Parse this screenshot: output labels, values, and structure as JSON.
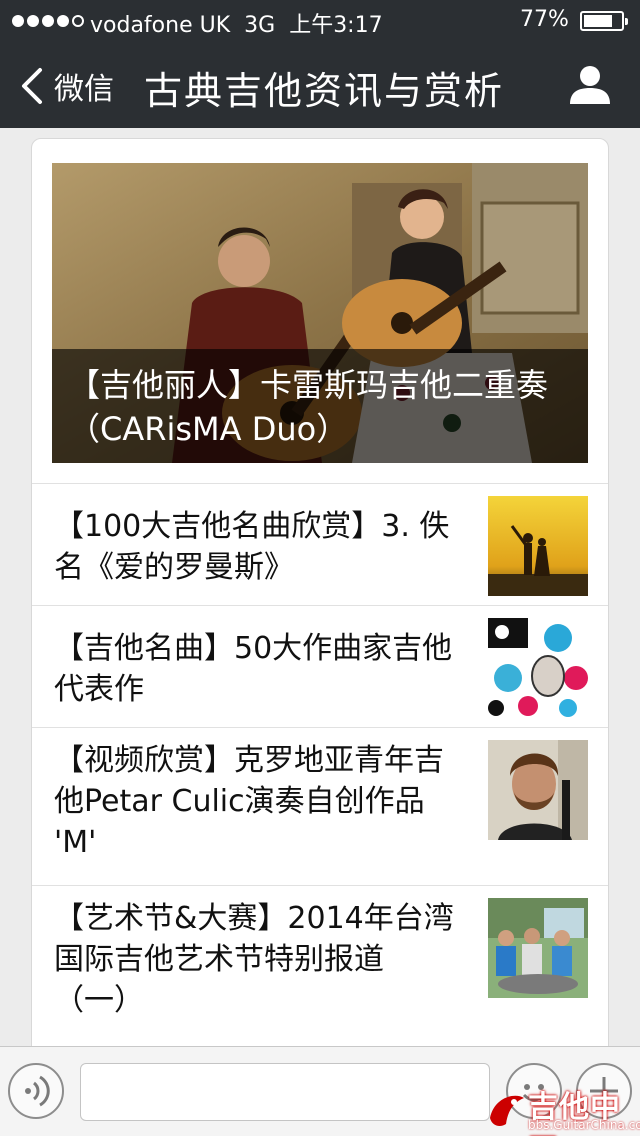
{
  "status_bar": {
    "carrier": "vodafone UK",
    "network": "3G",
    "time": "上午3:17",
    "battery_percent": "77%",
    "battery_level": 0.77,
    "signal_bars": 4
  },
  "nav": {
    "back_label": "微信",
    "title": "古典吉他资讯与赏析"
  },
  "hero": {
    "title": "【吉他丽人】卡雷斯玛吉他二重奏（CARisMA Duo）"
  },
  "articles": [
    {
      "title": "【100大吉他名曲欣赏】3. 佚名《爱的罗曼斯》",
      "thumb": "couple-sunset-thumbnail"
    },
    {
      "title": "【吉他名曲】50大作曲家吉他代表作",
      "thumb": "composers-collage-thumbnail"
    },
    {
      "title": "【视频欣赏】克罗地亚青年吉他Petar Culic演奏自创作品 'M'",
      "thumb": "guitarist-portrait-thumbnail"
    },
    {
      "title": "【艺术节&大赛】2014年台湾国际吉他艺术节特别报道（一）",
      "thumb": "festival-group-thumbnail"
    }
  ],
  "input_bar": {
    "value": "",
    "placeholder": ""
  },
  "watermark": {
    "text": "吉他中国",
    "url": "bbs.GuitarChina.com"
  },
  "colors": {
    "nav_background": "#2b2f33",
    "page_background": "#ececec",
    "card_background": "#ffffff",
    "watermark_red": "#cc0000"
  }
}
